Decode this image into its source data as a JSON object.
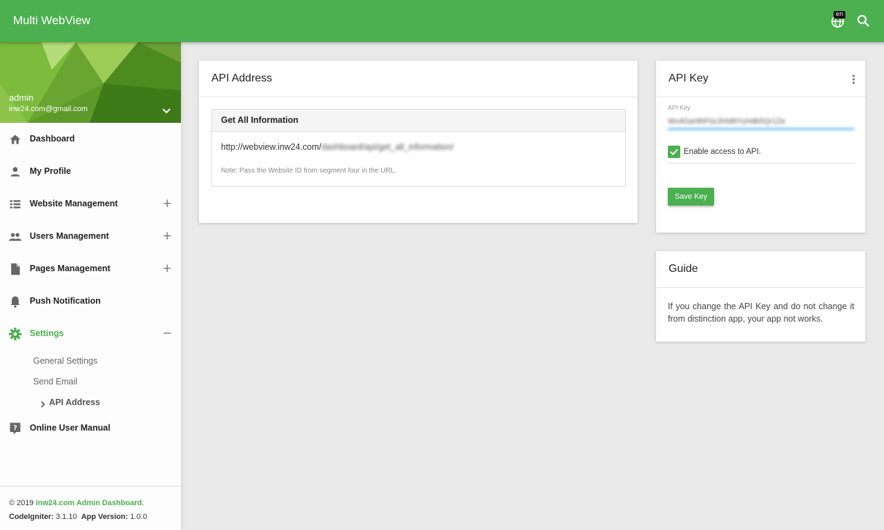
{
  "app": {
    "title": "Multi WebView",
    "lang": "en"
  },
  "user": {
    "name": "admin",
    "email": "inw24.com@gmail.com"
  },
  "sidebar": {
    "items": [
      {
        "label": "Dashboard"
      },
      {
        "label": "My Profile"
      },
      {
        "label": "Website Management",
        "toggle": "+"
      },
      {
        "label": "Users Management",
        "toggle": "+"
      },
      {
        "label": "Pages Management",
        "toggle": "+"
      },
      {
        "label": "Push Notification"
      },
      {
        "label": "Settings",
        "toggle": "−"
      },
      {
        "label": "Online User Manual"
      }
    ],
    "settings_sub": [
      "General Settings",
      "Send Email",
      "API Address"
    ],
    "accent_color": "#4caf50"
  },
  "footer": {
    "copyright": "© 2019",
    "link": "inw24.com Admin Dashboard",
    "period": ".",
    "ci_label": "CodeIgniter:",
    "ci_version": "3.1.10",
    "app_label": "App Version:",
    "app_version": "1.0.0"
  },
  "api_address": {
    "title": "API Address",
    "panel_title": "Get All Information",
    "url_base": "http://webview.inw24.com/",
    "url_rest": "dashboard/api/get_all_information/",
    "note": "Note: Pass the Website ID from segment four in the URL."
  },
  "api_key": {
    "title": "API Key",
    "field_label": "API Key",
    "field_value": "Wx4Gar9hF0zJhN8tYuHdb5Qr1Ze",
    "enable_label": "Enable access to API.",
    "enabled": true,
    "save_label": "Save Key"
  },
  "guide": {
    "title": "Guide",
    "text": "If you change the API Key and do not change it from distinction app, your app not works."
  }
}
